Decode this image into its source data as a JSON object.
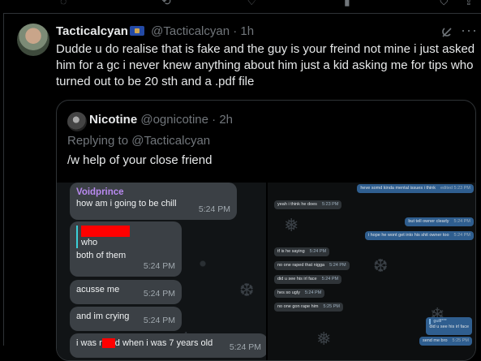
{
  "tweet": {
    "display_name": "Tacticalcyan",
    "handle": "@Tacticalcyan",
    "time": "1h",
    "text": "Dudde u do realise that is fake and the guy is your freind not mine i just asked him for a gc i never knew anything about him just a kid asking me for tips who turned out to be 20 sth and a .pdf file"
  },
  "quote": {
    "display_name": "Nicotine",
    "handle": "@ognicotine",
    "time": "2h",
    "replying_to_label": "Replying to",
    "replying_to_handle": "@Tacticalcyan",
    "text": "/w help of your close friend"
  },
  "chat_left": {
    "sender": "Voidprince",
    "messages": [
      {
        "text": "how am i going to be chill",
        "time": "5:24 PM"
      },
      {
        "reply_text": "who",
        "text": "both of them",
        "time": "5:24 PM"
      },
      {
        "text": "acusse me",
        "time": "5:24 PM"
      },
      {
        "text": "and im crying",
        "time": "5:24 PM"
      },
      {
        "text_before": "i was r",
        "text_after": "d when i was 7 years old",
        "time": "5:24 PM"
      }
    ]
  },
  "chat_right": {
    "messages": [
      {
        "dir": "out",
        "text": "heve somd kinda mental issues i think",
        "time": "edited 5:23 PM"
      },
      {
        "dir": "in",
        "text": "yeah i think he does",
        "time": "5:23 PM"
      },
      {
        "dir": "out",
        "text": "but tell owner clearly",
        "time": "5:24 PM"
      },
      {
        "dir": "out",
        "text": "i hope he wont get into his shit owner too",
        "time": "5:24 PM"
      },
      {
        "dir": "in",
        "text": "tf is he saying",
        "time": "5:24 PM"
      },
      {
        "dir": "in",
        "text": "no one raped that nigga",
        "time": "5:24 PM"
      },
      {
        "dir": "in",
        "text": "did u see his irl face",
        "time": "5:24 PM"
      },
      {
        "dir": "in",
        "text": "hes so ugly",
        "time": "5:24 PM"
      },
      {
        "dir": "in",
        "text": "no one gon rape him",
        "time": "5:25 PM"
      },
      {
        "dir": "out",
        "text": "did u see his irl face",
        "time": ""
      },
      {
        "dir": "out",
        "text": "send me bro",
        "time": "5:25 PM"
      }
    ]
  },
  "icons": [
    "grok-icon",
    "more-icon",
    "verified-flag-icon"
  ]
}
